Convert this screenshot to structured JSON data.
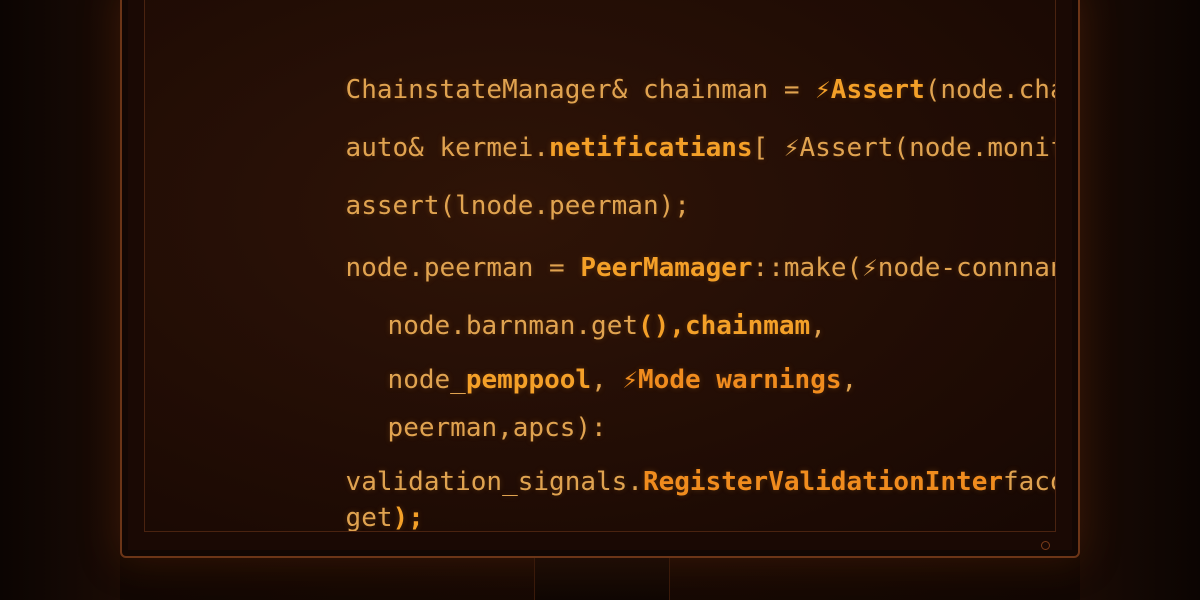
{
  "code": {
    "lines": [
      [
        "ChainstateManager& chainman = ",
        "⚡Assert",
        "(node.chaimman);"
      ],
      [
        "auto& kermei.",
        "netificatians",
        "[ ⚡Assert(node.monifications);"
      ],
      [
        "assert(lnode.peerman);"
      ],
      [
        "node.peerman = ",
        "PeerMamager",
        "::make(⚡node-connnan,"
      ],
      [
        "node.barnman.get",
        "(),chainmam",
        ","
      ],
      [
        "node_",
        "pemppool",
        ", ",
        "⚡Mode warnings",
        ","
      ],
      [
        "peerman,apcs):"
      ],
      [
        "validation_signals.",
        "RegisterValidationInter",
        "facode.peerman"
      ],
      [
        "get",
        ");"
      ]
    ]
  },
  "colors": {
    "text": "#e0a350",
    "highlight": "#f4a028",
    "frame": "#6b3517"
  }
}
